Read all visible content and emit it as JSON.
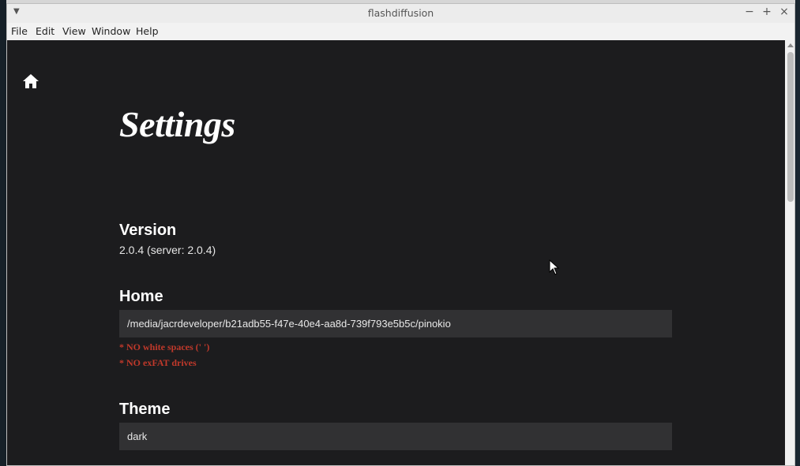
{
  "window": {
    "title": "flashdiffusion"
  },
  "menubar": {
    "items": [
      "File",
      "Edit",
      "View",
      "Window",
      "Help"
    ]
  },
  "icons": {
    "home": "home-icon",
    "cursor": "mouse-pointer-icon"
  },
  "page": {
    "title": "Settings",
    "version": {
      "label": "Version",
      "value": "2.0.4 (server: 2.0.4)"
    },
    "home": {
      "label": "Home",
      "value": "/media/jacrdeveloper/b21adb55-f47e-40e4-aa8d-739f793e5b5c/pinokio",
      "warnings": [
        "* NO white spaces (' ')",
        "* NO exFAT drives"
      ]
    },
    "theme": {
      "label": "Theme",
      "value": "dark"
    }
  },
  "colors": {
    "background": "#1c1c1e",
    "field": "#313133",
    "warning": "#c0392b"
  }
}
